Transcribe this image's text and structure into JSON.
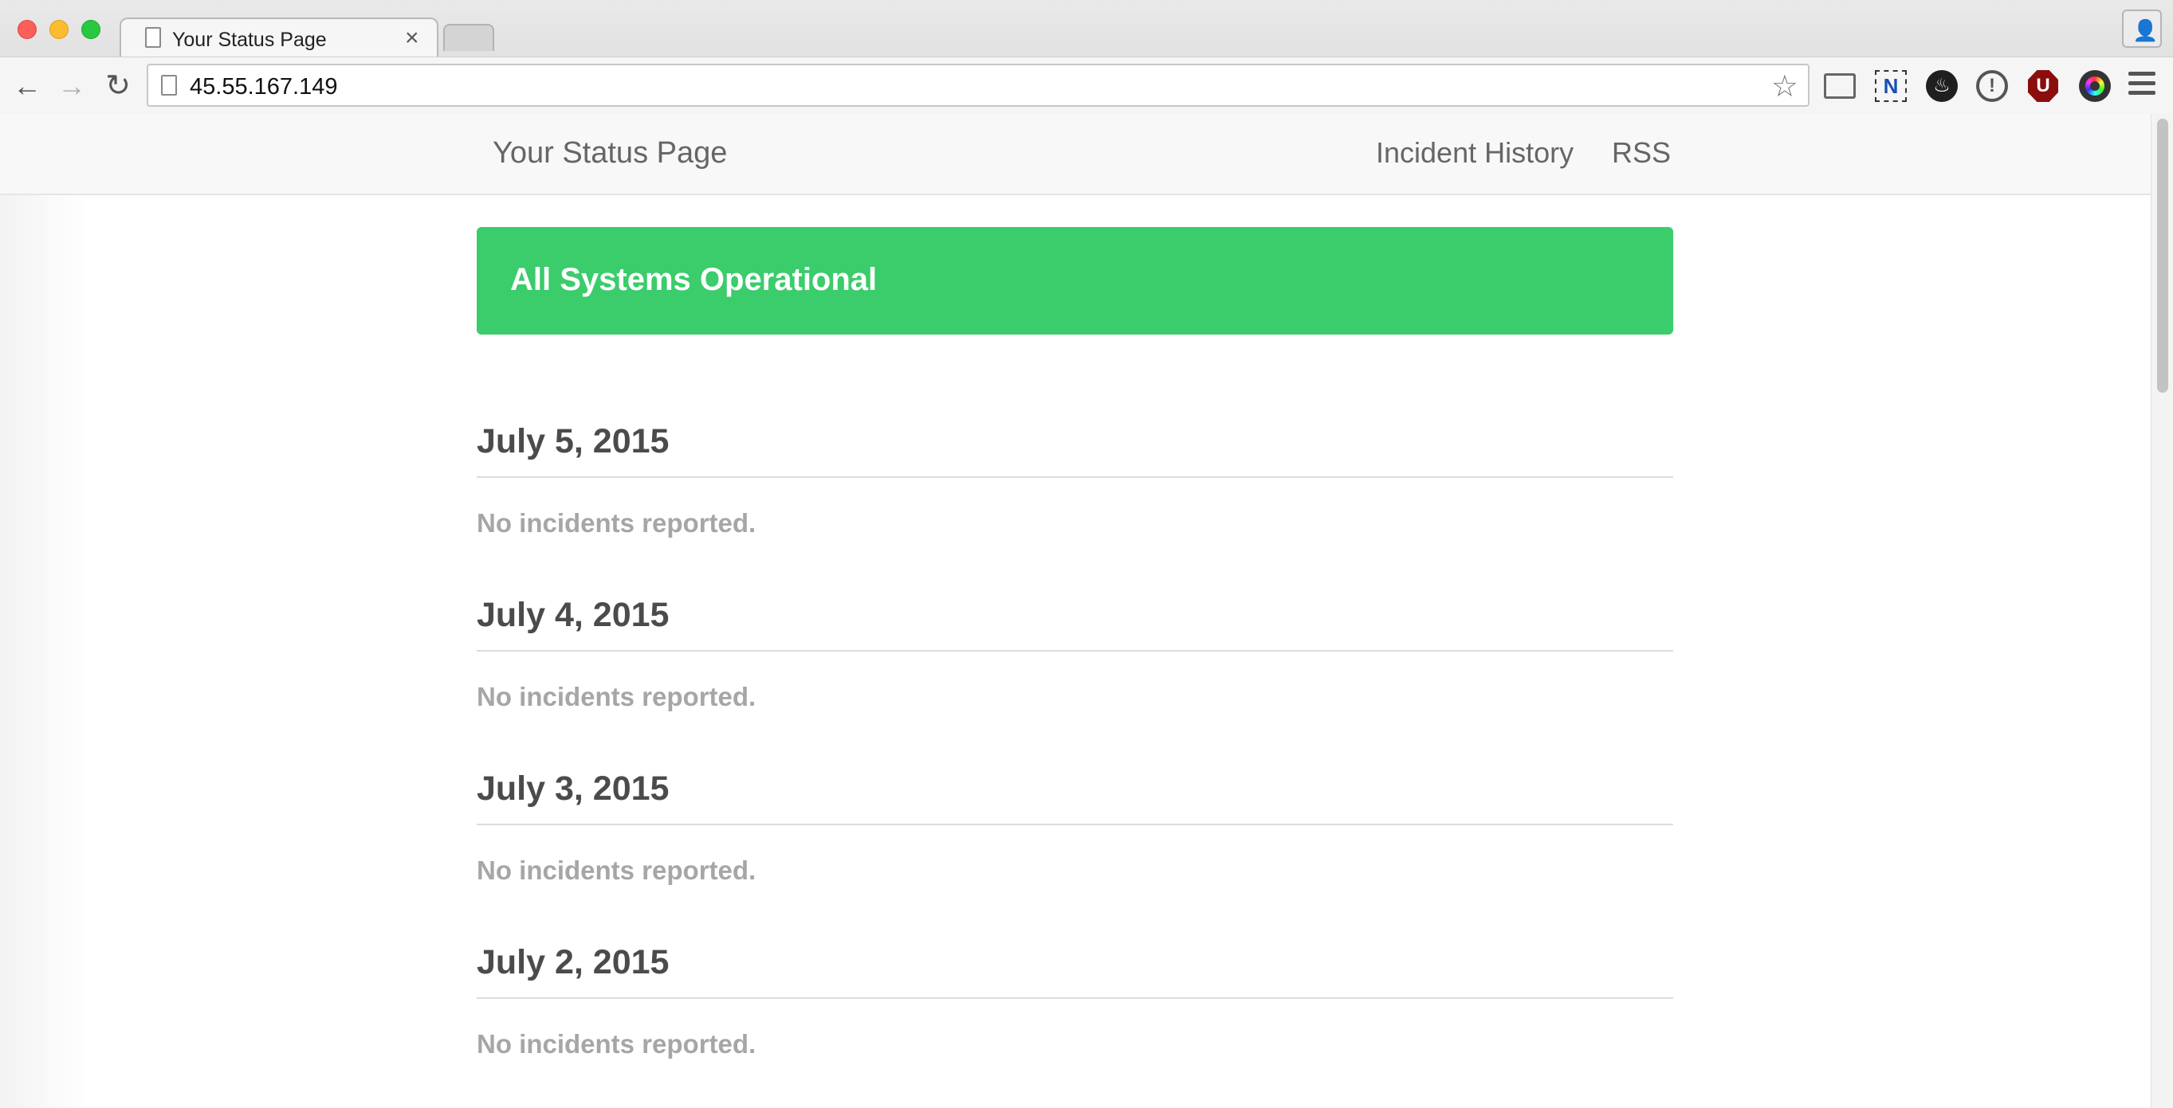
{
  "browser": {
    "tab_title": "Your Status Page",
    "url": "45.55.167.149",
    "close_glyph": "×"
  },
  "site": {
    "brand": "Your Status Page",
    "nav": {
      "incident_history": "Incident History",
      "rss": "RSS"
    },
    "status_banner": {
      "text": "All Systems Operational",
      "color": "#3bcc6b"
    },
    "days": [
      {
        "date": "July 5, 2015",
        "message": "No incidents reported."
      },
      {
        "date": "July 4, 2015",
        "message": "No incidents reported."
      },
      {
        "date": "July 3, 2015",
        "message": "No incidents reported."
      },
      {
        "date": "July 2, 2015",
        "message": "No incidents reported."
      }
    ]
  }
}
